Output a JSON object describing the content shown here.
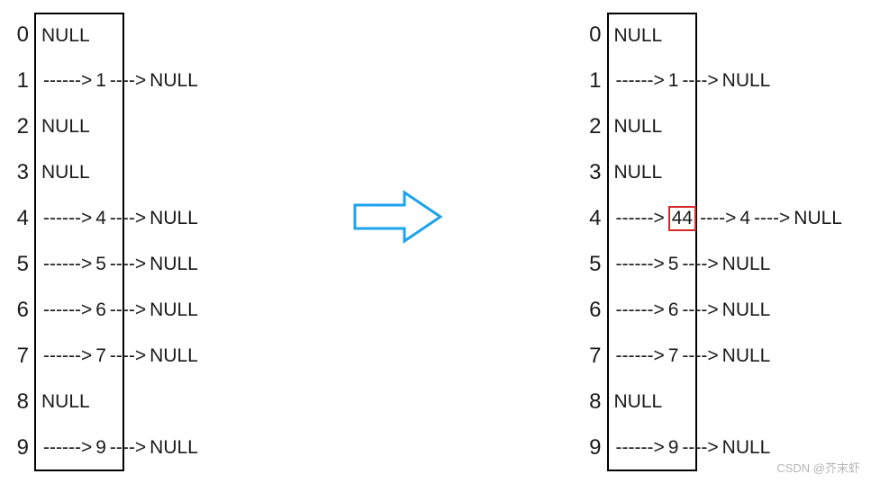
{
  "leftTable": {
    "rows": [
      {
        "index": "0",
        "content": "NULL",
        "chain": null
      },
      {
        "index": "1",
        "content": "",
        "chain": [
          "1",
          "NULL"
        ]
      },
      {
        "index": "2",
        "content": "NULL",
        "chain": null
      },
      {
        "index": "3",
        "content": "NULL",
        "chain": null
      },
      {
        "index": "4",
        "content": "",
        "chain": [
          "4",
          "NULL"
        ]
      },
      {
        "index": "5",
        "content": "",
        "chain": [
          "5",
          "NULL"
        ]
      },
      {
        "index": "6",
        "content": "",
        "chain": [
          "6",
          "NULL"
        ]
      },
      {
        "index": "7",
        "content": "",
        "chain": [
          "7",
          "NULL"
        ]
      },
      {
        "index": "8",
        "content": "NULL",
        "chain": null
      },
      {
        "index": "9",
        "content": "",
        "chain": [
          "9",
          "NULL"
        ]
      }
    ]
  },
  "rightTable": {
    "rows": [
      {
        "index": "0",
        "content": "NULL",
        "chain": null
      },
      {
        "index": "1",
        "content": "",
        "chain": [
          "1",
          "NULL"
        ]
      },
      {
        "index": "2",
        "content": "NULL",
        "chain": null
      },
      {
        "index": "3",
        "content": "NULL",
        "chain": null
      },
      {
        "index": "4",
        "content": "",
        "chain": [
          "44",
          "4",
          "NULL"
        ],
        "highlight": "44"
      },
      {
        "index": "5",
        "content": "",
        "chain": [
          "5",
          "NULL"
        ]
      },
      {
        "index": "6",
        "content": "",
        "chain": [
          "6",
          "NULL"
        ]
      },
      {
        "index": "7",
        "content": "",
        "chain": [
          "7",
          "NULL"
        ]
      },
      {
        "index": "8",
        "content": "NULL",
        "chain": null
      },
      {
        "index": "9",
        "content": "",
        "chain": [
          "9",
          "NULL"
        ]
      }
    ]
  },
  "arrowSegLong": "------>",
  "arrowSegShort": "---->",
  "watermark": "CSDN @芥末虾"
}
